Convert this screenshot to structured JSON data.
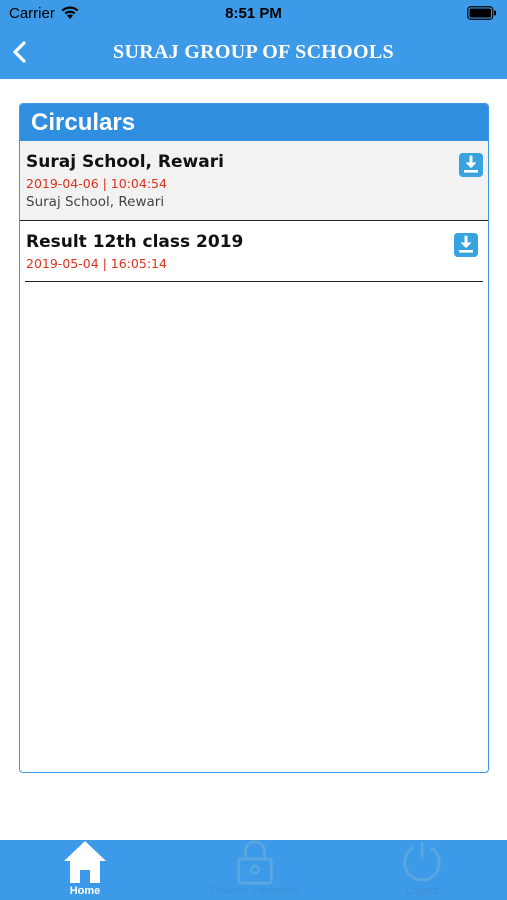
{
  "status_bar": {
    "carrier": "Carrier",
    "time": "8:51 PM"
  },
  "nav": {
    "title": "SURAJ GROUP OF SCHOOLS",
    "back_icon": "chevron-left-icon"
  },
  "card": {
    "title": "Circulars",
    "items": [
      {
        "title": "Suraj School, Rewari",
        "datetime": "2019-04-06 | 10:04:54",
        "subtitle": "Suraj School, Rewari",
        "icon": "download-icon"
      },
      {
        "title": "Result 12th class 2019",
        "datetime": "2019-05-04 | 16:05:14",
        "icon": "download-icon"
      }
    ]
  },
  "tabbar": {
    "home_label": "Home",
    "password_label": "Change Password",
    "logout_label": "Logout",
    "active": "Home"
  },
  "colors": {
    "primary": "#3d9ae8",
    "header": "#2f8ee0",
    "date_text": "#e0301e"
  }
}
